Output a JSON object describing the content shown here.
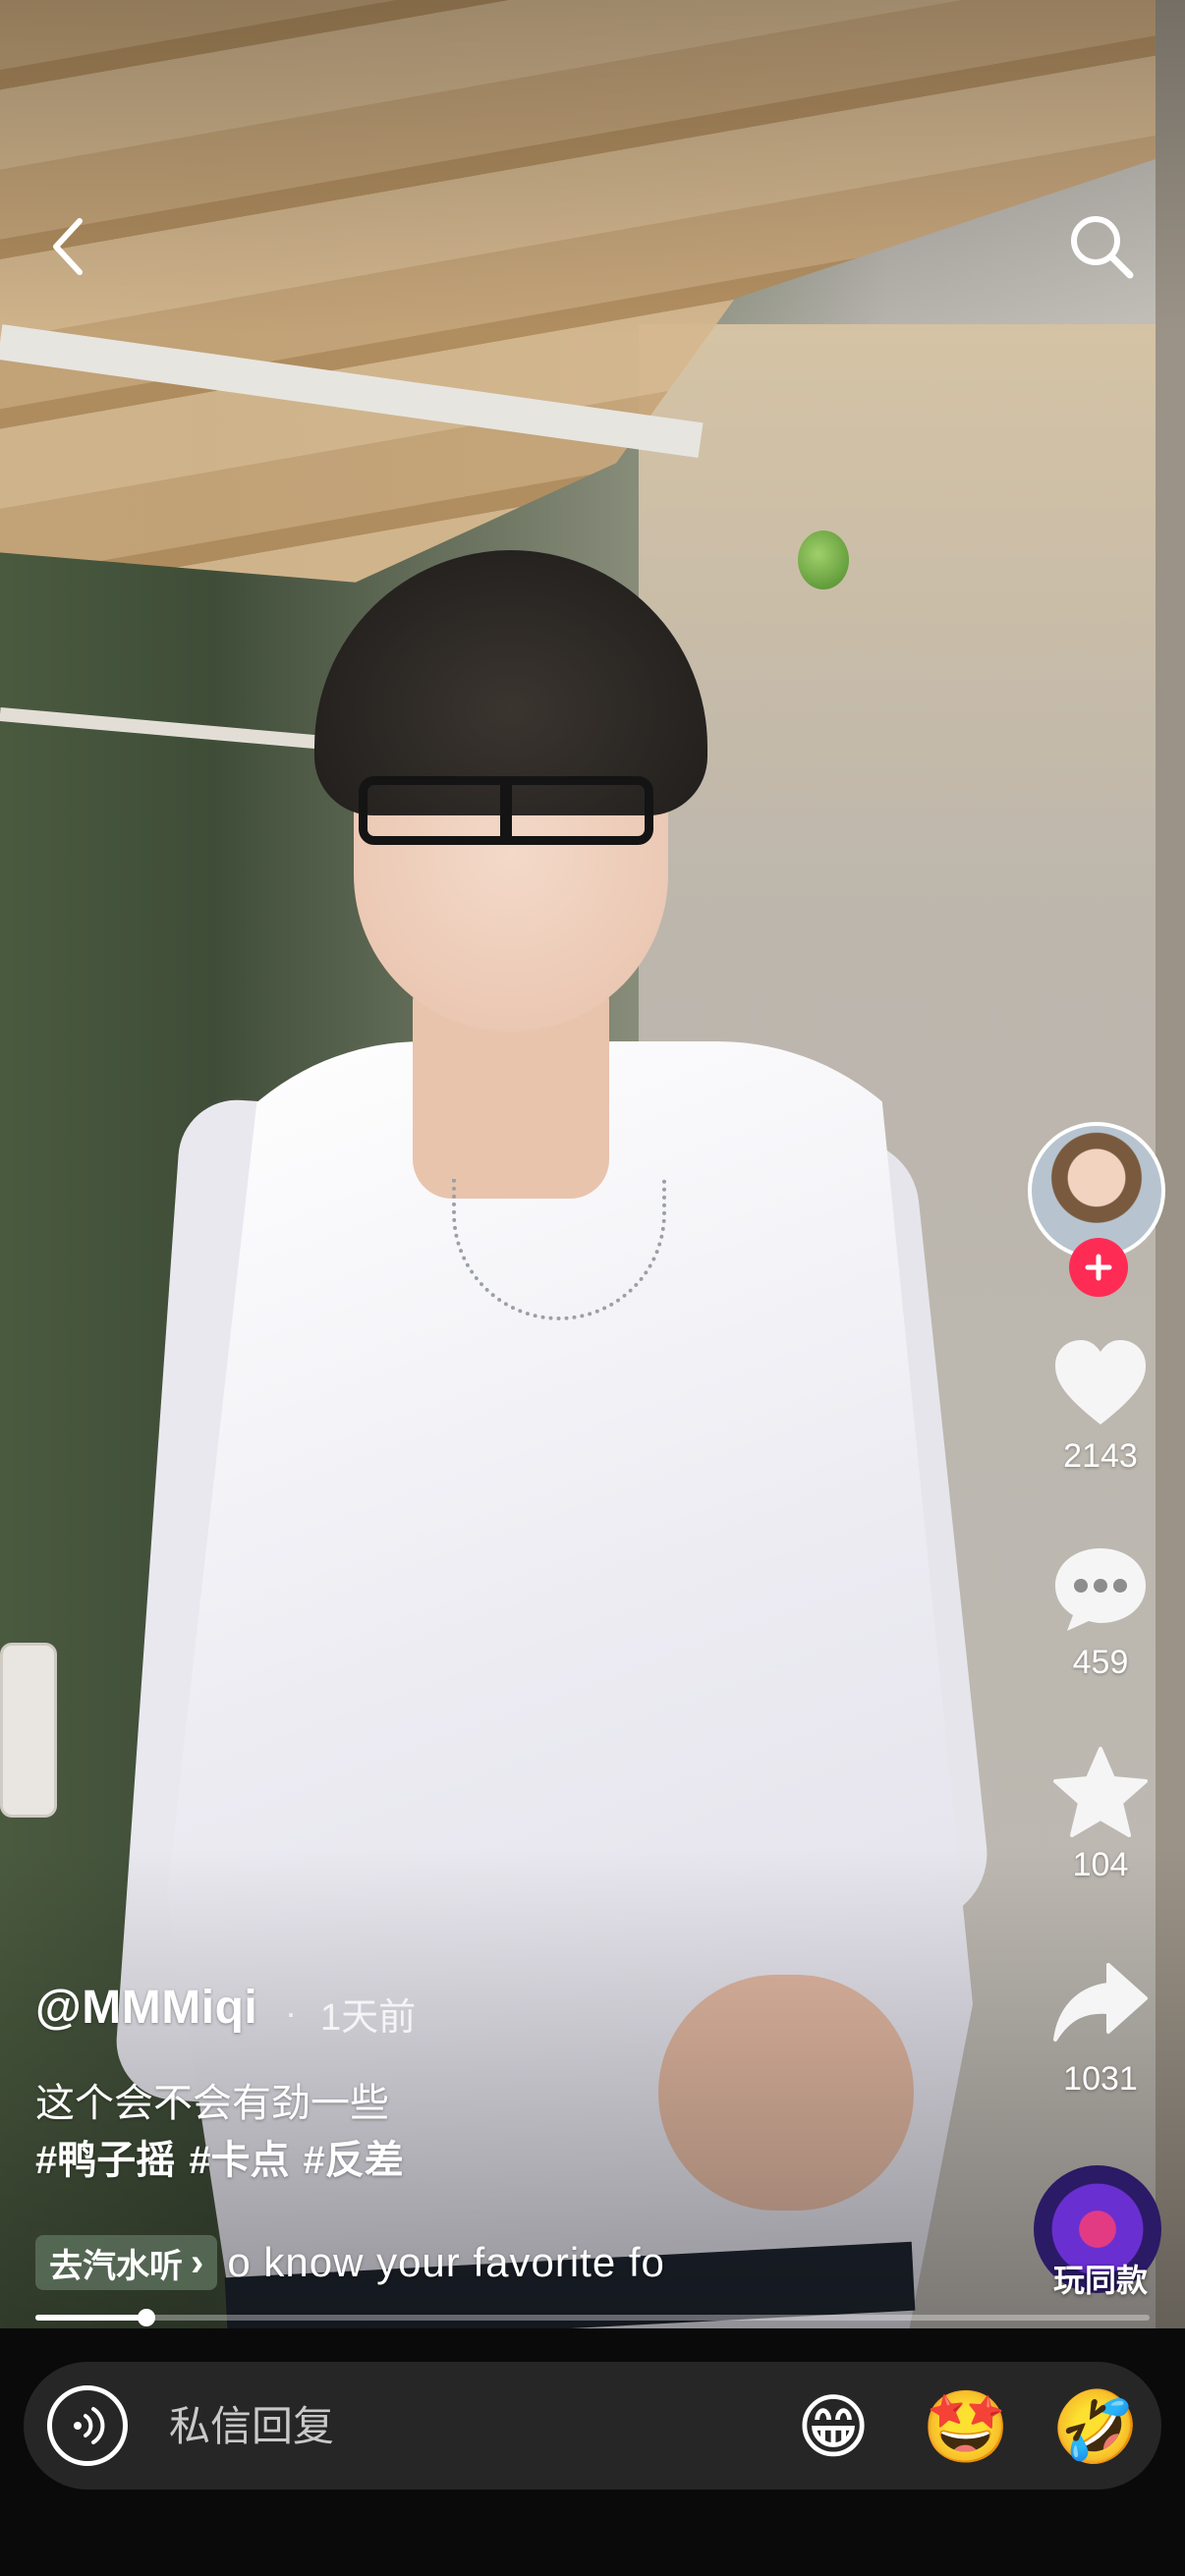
{
  "author": {
    "handle": "@MMMiqi",
    "separator": "·",
    "posted": "1天前"
  },
  "caption": {
    "text": "这个会不会有劲一些",
    "hashtags": [
      "#鸭子摇",
      "#卡点",
      "#反差"
    ]
  },
  "music": {
    "chip_label": "去汽水听",
    "chip_chevron": "›",
    "scrolling_text": "o know your favorite fo"
  },
  "actions": {
    "likes": "2143",
    "comments": "459",
    "favorites": "104",
    "shares": "1031"
  },
  "same_style_label": "玩同款",
  "progress": {
    "fraction": 0.1
  },
  "reply": {
    "placeholder": "私信回复"
  },
  "quick_emojis": [
    "😁",
    "🤩",
    "🤣"
  ],
  "colors": {
    "follow_red": "#fe2c55",
    "bottom_bar": "#0a0a0a",
    "reply_box": "#262626"
  },
  "icons": [
    "back-icon",
    "search-icon",
    "plus-icon",
    "heart-icon",
    "comment-icon",
    "star-icon",
    "share-icon",
    "voice-icon"
  ]
}
